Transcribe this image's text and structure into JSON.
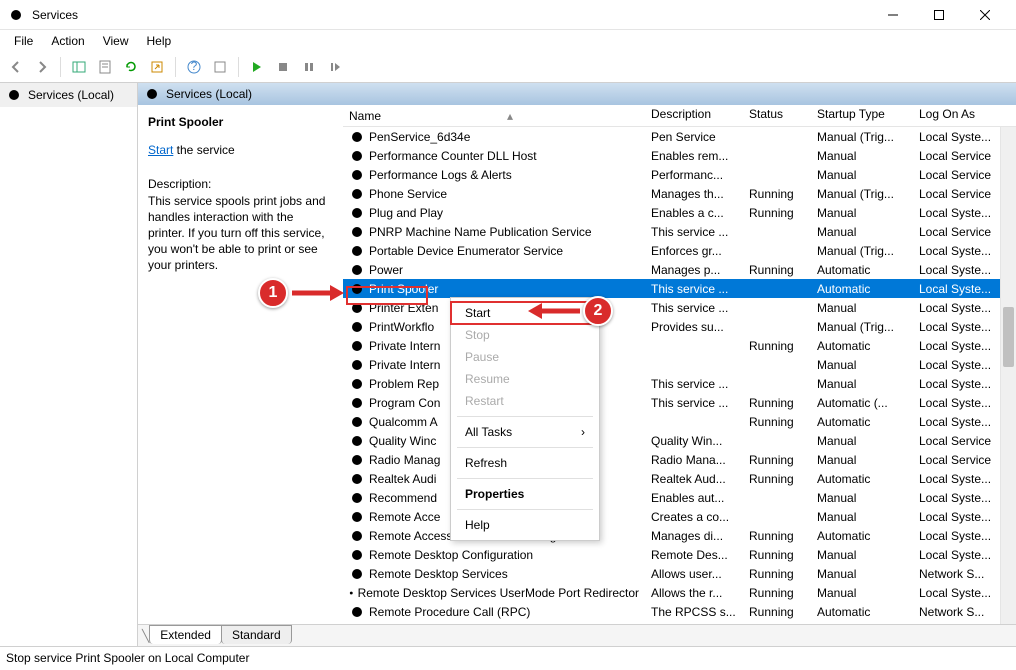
{
  "window": {
    "title": "Services"
  },
  "menubar": [
    "File",
    "Action",
    "View",
    "Help"
  ],
  "leftPane": {
    "label": "Services (Local)"
  },
  "paneHeader": "Services (Local)",
  "detail": {
    "serviceName": "Print Spooler",
    "startLink": "Start",
    "startSuffix": " the service",
    "descLabel": "Description:",
    "descText": "This service spools print jobs and handles interaction with the printer. If you turn off this service, you won't be able to print or see your printers."
  },
  "columns": {
    "name": "Name",
    "description": "Description",
    "status": "Status",
    "startup": "Startup Type",
    "logon": "Log On As"
  },
  "services": [
    {
      "name": "PenService_6d34e",
      "desc": "Pen Service",
      "status": "",
      "startup": "Manual (Trig...",
      "logon": "Local Syste..."
    },
    {
      "name": "Performance Counter DLL Host",
      "desc": "Enables rem...",
      "status": "",
      "startup": "Manual",
      "logon": "Local Service"
    },
    {
      "name": "Performance Logs & Alerts",
      "desc": "Performanc...",
      "status": "",
      "startup": "Manual",
      "logon": "Local Service"
    },
    {
      "name": "Phone Service",
      "desc": "Manages th...",
      "status": "Running",
      "startup": "Manual (Trig...",
      "logon": "Local Service"
    },
    {
      "name": "Plug and Play",
      "desc": "Enables a c...",
      "status": "Running",
      "startup": "Manual",
      "logon": "Local Syste..."
    },
    {
      "name": "PNRP Machine Name Publication Service",
      "desc": "This service ...",
      "status": "",
      "startup": "Manual",
      "logon": "Local Service"
    },
    {
      "name": "Portable Device Enumerator Service",
      "desc": "Enforces gr...",
      "status": "",
      "startup": "Manual (Trig...",
      "logon": "Local Syste..."
    },
    {
      "name": "Power",
      "desc": "Manages p...",
      "status": "Running",
      "startup": "Automatic",
      "logon": "Local Syste..."
    },
    {
      "name": "Print Spooler",
      "desc": "This service ...",
      "status": "",
      "startup": "Automatic",
      "logon": "Local Syste...",
      "selected": true
    },
    {
      "name": "Printer Exten",
      "desc": "This service ...",
      "status": "",
      "startup": "Manual",
      "logon": "Local Syste..."
    },
    {
      "name": "PrintWorkflo",
      "desc": "Provides su...",
      "status": "",
      "startup": "Manual (Trig...",
      "logon": "Local Syste..."
    },
    {
      "name": "Private Intern",
      "desc": "",
      "status": "Running",
      "startup": "Automatic",
      "logon": "Local Syste..."
    },
    {
      "name": "Private Intern",
      "desc": "",
      "status": "",
      "startup": "Manual",
      "logon": "Local Syste..."
    },
    {
      "name": "Problem Rep",
      "desc": "This service ...",
      "status": "",
      "startup": "Manual",
      "logon": "Local Syste..."
    },
    {
      "name": "Program Con",
      "desc": "This service ...",
      "status": "Running",
      "startup": "Automatic (...",
      "logon": "Local Syste..."
    },
    {
      "name": "Qualcomm A",
      "desc": "",
      "status": "Running",
      "startup": "Automatic",
      "logon": "Local Syste..."
    },
    {
      "name": "Quality Winc",
      "desc": "Quality Win...",
      "status": "",
      "startup": "Manual",
      "logon": "Local Service"
    },
    {
      "name": "Radio Manag",
      "desc": "Radio Mana...",
      "status": "Running",
      "startup": "Manual",
      "logon": "Local Service"
    },
    {
      "name": "Realtek Audi",
      "desc": "Realtek Aud...",
      "status": "Running",
      "startup": "Automatic",
      "logon": "Local Syste..."
    },
    {
      "name": "Recommend",
      "desc": "Enables aut...",
      "status": "",
      "startup": "Manual",
      "logon": "Local Syste..."
    },
    {
      "name": "Remote Acce",
      "desc": "Creates a co...",
      "status": "",
      "startup": "Manual",
      "logon": "Local Syste..."
    },
    {
      "name": "Remote Access Connection Manager",
      "desc": "Manages di...",
      "status": "Running",
      "startup": "Automatic",
      "logon": "Local Syste..."
    },
    {
      "name": "Remote Desktop Configuration",
      "desc": "Remote Des...",
      "status": "Running",
      "startup": "Manual",
      "logon": "Local Syste..."
    },
    {
      "name": "Remote Desktop Services",
      "desc": "Allows user...",
      "status": "Running",
      "startup": "Manual",
      "logon": "Network S..."
    },
    {
      "name": "Remote Desktop Services UserMode Port Redirector",
      "desc": "Allows the r...",
      "status": "Running",
      "startup": "Manual",
      "logon": "Local Syste..."
    },
    {
      "name": "Remote Procedure Call (RPC)",
      "desc": "The RPCSS s...",
      "status": "Running",
      "startup": "Automatic",
      "logon": "Network S..."
    }
  ],
  "contextMenu": [
    {
      "label": "Start",
      "enabled": true,
      "highlight": true
    },
    {
      "label": "Stop",
      "enabled": false
    },
    {
      "label": "Pause",
      "enabled": false
    },
    {
      "label": "Resume",
      "enabled": false
    },
    {
      "label": "Restart",
      "enabled": false
    },
    {
      "divider": true
    },
    {
      "label": "All Tasks",
      "enabled": true,
      "submenu": true
    },
    {
      "divider": true
    },
    {
      "label": "Refresh",
      "enabled": true
    },
    {
      "divider": true
    },
    {
      "label": "Properties",
      "enabled": true,
      "bold": true
    },
    {
      "divider": true
    },
    {
      "label": "Help",
      "enabled": true
    }
  ],
  "tabs": {
    "extended": "Extended",
    "standard": "Standard"
  },
  "statusbar": "Stop service Print Spooler on Local Computer",
  "annotations": {
    "marker1": "1",
    "marker2": "2"
  }
}
